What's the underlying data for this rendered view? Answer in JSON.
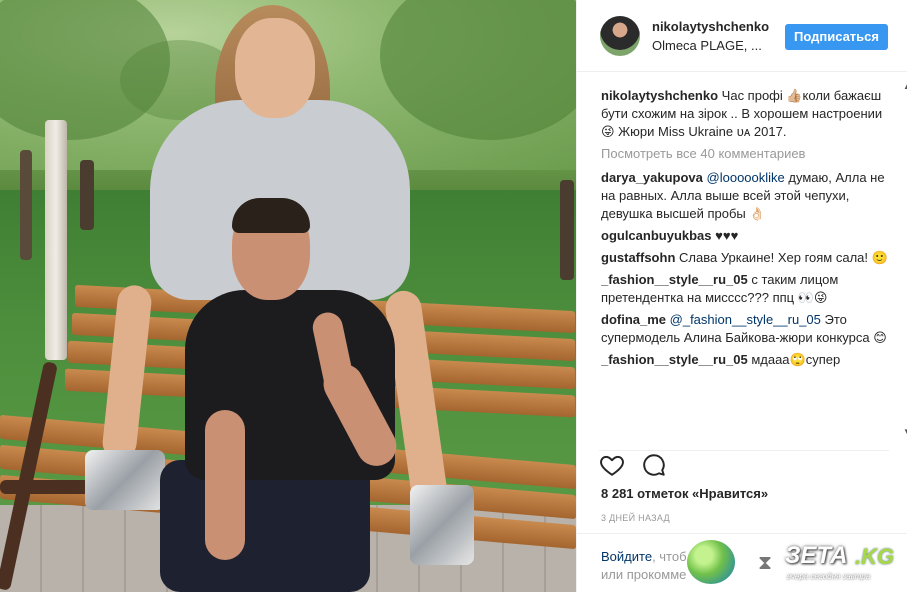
{
  "colors": {
    "accent": "#3897f0",
    "link": "#003569",
    "muted": "#999999",
    "text": "#262626"
  },
  "header": {
    "username": "nikolaytyshchenko",
    "location": "Olmeca PLAGE, ...",
    "follow_label": "Подписаться"
  },
  "caption": {
    "user": "nikolaytyshchenko",
    "text": "Час профі 👍🏼коли бажаєш бути схожим на зірок .. В хорошем настроении 😜 Жюри Miss Ukraine ᴜᴀ 2017."
  },
  "view_all_comments": "Посмотреть все 40 комментариев",
  "comments": [
    {
      "user": "darya_yakupova",
      "mention": "@loooooklike",
      "text": " думаю, Алла не на равных. Алла выше всей этой чепухи, девушка высшей пробы 👌🏻"
    },
    {
      "user": "ogulcanbuyukbas",
      "mention": "",
      "text": "♥♥♥"
    },
    {
      "user": "gustaffsohn",
      "mention": "",
      "text": "Слава Уркаине! Хер гоям сала! 🙂"
    },
    {
      "user": "_fashion__style__ru_05",
      "mention": "",
      "text": "с таким лицом претендентка на мисссс??? ппц 👀😜"
    },
    {
      "user": "dofina_me",
      "mention": "@_fashion__style__ru_05",
      "text": " Это супермодель Алина Байкова-жюри конкурса 😊"
    },
    {
      "user": "_fashion__style__ru_05",
      "mention": "",
      "text": "мдааа🙄супер"
    }
  ],
  "icons": {
    "like": "heart-outline-icon",
    "comment": "speech-bubble-icon"
  },
  "likes_text": "8 281 отметок «Нравится»",
  "time_text": "3 дней назад",
  "login": {
    "login_link": "Войдите",
    "middle": ", чтоб",
    "tail": "или прокомме"
  },
  "watermark": {
    "brand": "ЗЕТА",
    "domain": ".KG",
    "slogan": "вчера сегодня завтра"
  }
}
